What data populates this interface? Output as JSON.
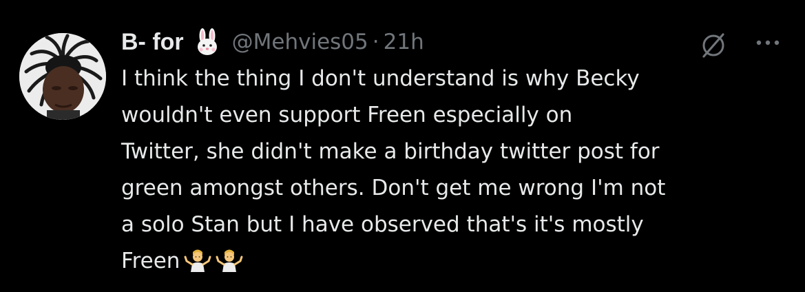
{
  "tweet": {
    "display_name": "B- for",
    "name_emoji_icon": "rabbit-face-icon",
    "handle": "@Mehvies05",
    "separator": "·",
    "timestamp": "21h",
    "text_lines": [
      "I think the thing I don't understand is why Becky",
      "wouldn't even support Freen especially on",
      "Twitter, she didn't make a birthday twitter post for",
      "green amongst others. Don't get me wrong I'm not",
      "a solo Stan but I have observed that's it's mostly",
      "Freen"
    ],
    "trailing_emoji_icons": [
      "man-shrugging-icon",
      "man-shrugging-icon"
    ],
    "actions": {
      "grok_icon": "grok-slash-icon",
      "more_icon": "more-dots-icon"
    }
  },
  "colors": {
    "background": "#000000",
    "text_primary": "#e7e9ea",
    "text_secondary": "#71767b"
  }
}
